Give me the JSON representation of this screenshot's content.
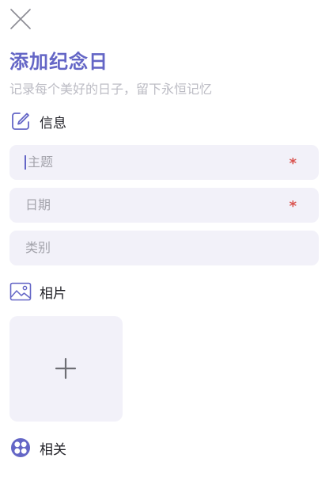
{
  "header": {
    "title": "添加纪念日",
    "subtitle": "记录每个美好的日子，留下永恒记忆"
  },
  "sections": {
    "info": {
      "label": "信息",
      "icon": "edit-icon"
    },
    "photos": {
      "label": "相片",
      "icon": "image-icon"
    },
    "related": {
      "label": "相关",
      "icon": "grid-circle-icon"
    }
  },
  "form": {
    "subject": {
      "placeholder": "主题",
      "required_mark": "*"
    },
    "date": {
      "placeholder": "日期",
      "required_mark": "*"
    },
    "category": {
      "placeholder": "类别"
    }
  },
  "colors": {
    "accent": "#6466c6",
    "field_bg": "#f2f1f9",
    "required": "#d9534f",
    "placeholder": "#a4a4ac"
  }
}
